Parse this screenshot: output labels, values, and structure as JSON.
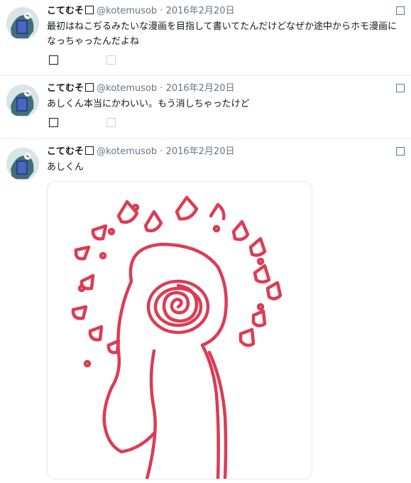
{
  "tweets": [
    {
      "name": "こてむそ",
      "handle": "@kotemusob",
      "dot": "·",
      "date": "2016年2月20日",
      "text": "最初はねこぢるみたいな漫画を目指して書いてたんだけどなぜか途中からホモ漫画になっちゃったんだよね"
    },
    {
      "name": "こてむそ",
      "handle": "@kotemusob",
      "dot": "·",
      "date": "2016年2月20日",
      "text": "あしくん本当にかわいい。もう消しちゃったけど"
    },
    {
      "name": "こてむそ",
      "handle": "@kotemusob",
      "dot": "·",
      "date": "2016年2月20日",
      "text": "あしくん"
    }
  ],
  "colors": {
    "drawing": "#dc3c54",
    "muted": "#657786",
    "separator": "#e6ecf0"
  }
}
